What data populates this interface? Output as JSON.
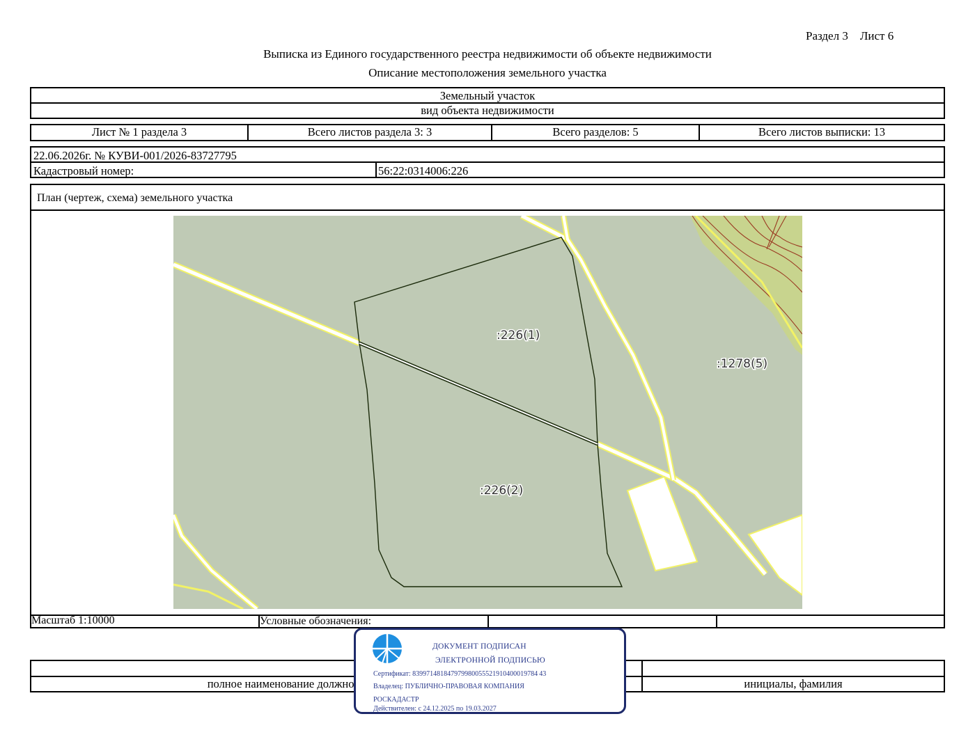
{
  "header": {
    "section_sheet": "Раздел 3    Лист 6",
    "title": "Выписка из Единого государственного реестра недвижимости об объекте недвижимости",
    "subtitle": "Описание местоположения земельного участка"
  },
  "object": {
    "name": "Земельный участок",
    "kind_caption": "вид объекта недвижимости"
  },
  "sheets": {
    "sheet_no": "Лист № 1 раздела 3",
    "total_sheets_section": "Всего листов раздела 3: 3",
    "total_sections": "Всего разделов: 5",
    "total_sheets_extract": "Всего листов выписки: 13"
  },
  "record": {
    "date_number": "22.06.2026г. № КУВИ-001/2026-83727795",
    "cadastral_label": "Кадастровый номер:",
    "cadastral_value": "56:22:0314006:226"
  },
  "plan": {
    "caption": "План (чертеж, схема) земельного участка",
    "labels": {
      "parcel_1": ":226(1)",
      "parcel_2": ":226(2)",
      "neighbor": ":1278(5)"
    },
    "colors": {
      "land": "#bfcab5",
      "road": "#ffffff",
      "road_edge": "#f2f266",
      "boundary": "#1a2a0a",
      "relief": "#9a3a22",
      "relief_fill": "#c8d48e"
    }
  },
  "footer": {
    "scale": "Масштаб 1:10000",
    "legend_label": "Условные обозначения:",
    "position_caption": "полное наименование должности",
    "name_caption": "инициалы, фамилия"
  },
  "stamp": {
    "line1": "ДОКУМЕНТ ПОДПИСАН",
    "line2": "ЭЛЕКТРОННОЙ ПОДПИСЬЮ",
    "certificate": "Сертификат: 839971481847979980055521910400019784 43",
    "owner": "Владелец: ПУБЛИЧНО-ПРАВОВАЯ КОМПАНИЯ",
    "owner_cont": "РОСКАДАСТР",
    "valid": "Действителен: с 24.12.2025 по 19.03.2027",
    "logo_icon": "roskadastr-logo-icon",
    "color": "#1e2a6b"
  }
}
